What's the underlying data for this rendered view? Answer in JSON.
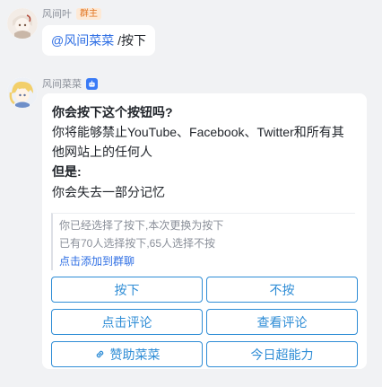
{
  "messages": [
    {
      "sender": "风间叶",
      "role_badge": "群主",
      "mention": "@风间菜菜",
      "text": " /按下"
    },
    {
      "sender": "风间菜菜",
      "card": {
        "question": "你会按下这个按钮吗?",
        "desc_line1": "你将能够禁止YouTube、Facebook、Twitter和所有其",
        "desc_line2": "他网站上的任何人",
        "but_label": "但是:",
        "consequence": "你会失去一部分记忆",
        "quote_line1": "你已经选择了按下,本次更换为按下",
        "quote_line2": "已有70人选择按下,65人选择不按",
        "quote_link": "点击添加到群聊",
        "buttons": {
          "press": "按下",
          "no_press": "不按",
          "comment": "点击评论",
          "view_comments": "查看评论",
          "sponsor": "赞助菜菜",
          "superpower": "今日超能力"
        }
      }
    }
  ],
  "colors": {
    "accent": "#2f8dd6",
    "link": "#2f6fe4",
    "owner_badge_text": "#e0731f",
    "owner_badge_bg": "#fde9d6",
    "bot_badge": "#3a7bf6",
    "background": "#f1f2f4"
  },
  "icons": {
    "bot_badge": "robot-icon",
    "sponsor": "link-icon"
  }
}
